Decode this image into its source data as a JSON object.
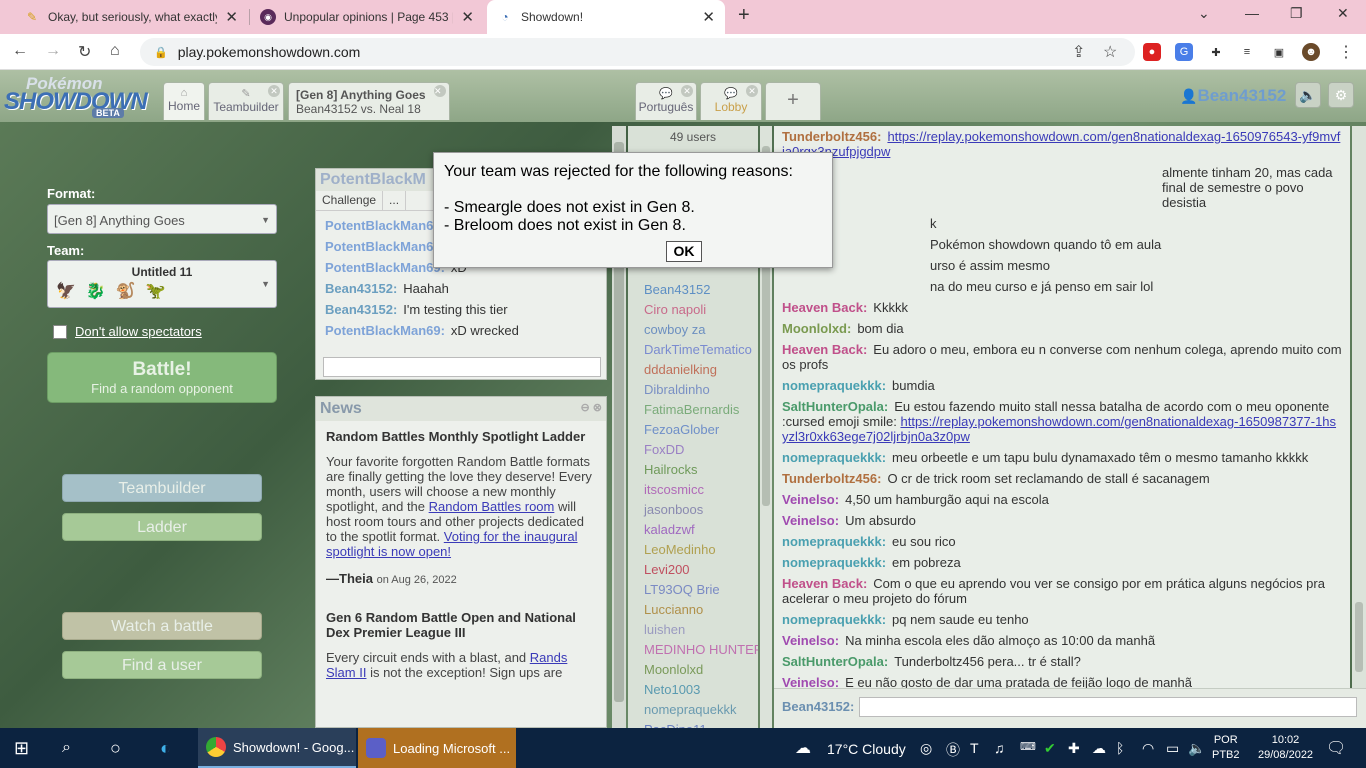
{
  "browser": {
    "tabs": [
      {
        "title": "Okay, but seriously, what exactly",
        "icon": "pencil-icon"
      },
      {
        "title": "Unpopular opinions | Page 453 | S",
        "icon": "forum-icon"
      },
      {
        "title": "Showdown!",
        "icon": "pokeball-icon"
      }
    ],
    "new_tab": "+",
    "url": "play.pokemonshowdown.com"
  },
  "ps_header": {
    "logo_top": "Pokémon",
    "logo_main": "SHOWDOWN",
    "logo_badge": "BETA",
    "home_label": "Home",
    "teambuilder_label": "Teambuilder",
    "room_title": "[Gen 8] Anything Goes",
    "room_sub": "Bean43152 vs. Neal 18",
    "portugues_label": "Português",
    "lobby_label": "Lobby",
    "add_label": "+",
    "username": "Bean43152"
  },
  "left": {
    "format_label": "Format:",
    "format_value": "[Gen 8] Anything Goes",
    "team_label": "Team:",
    "team_value": "Untitled 11",
    "team_mons": "🦅🐉🐒🦖",
    "spectators_label": "Don't allow spectators",
    "battle_label": "Battle!",
    "battle_sub": "Find a random opponent",
    "teambuilder_btn": "Teambuilder",
    "ladder_btn": "Ladder",
    "watch_btn": "Watch a battle",
    "find_btn": "Find a user"
  },
  "mini_chat": {
    "title": "PotentBlackM",
    "challenge": "Challenge",
    "more": "...",
    "rows": [
      {
        "name": "PotentBlackMan69:",
        "msg": "",
        "color": "#7ea3d8"
      },
      {
        "name": "PotentBlackMan69:",
        "msg": "",
        "color": "#7ea3d8"
      },
      {
        "name": "PotentBlackMan69:",
        "msg": "xD",
        "color": "#7ea3d8"
      },
      {
        "name": "Bean43152:",
        "msg": "Haahah",
        "color": "#6b9fc0"
      },
      {
        "name": "Bean43152:",
        "msg": "I'm testing this tier",
        "color": "#6b9fc0"
      },
      {
        "name": "PotentBlackMan69:",
        "msg": "xD wrecked",
        "color": "#7ea3d8"
      }
    ]
  },
  "news": {
    "title": "News",
    "item1_title": "Random Battles Monthly Spotlight Ladder",
    "item1_p1": "Your favorite forgotten Random Battle formats are finally getting the love they deserve! Every month, users will choose a new monthly spotlight, and the ",
    "item1_link1": "Random Battles room",
    "item1_p2": " will host room tours and other projects dedicated to the spotlit format. ",
    "item1_link2": "Voting for the inaugural spotlight is now open!",
    "item1_author": "—Theia",
    "item1_date": "on Aug 26, 2022",
    "item2_title": "Gen 6 Random Battle Open and National Dex Premier League III",
    "item2_p1": "Every circuit ends with a blast, and ",
    "item2_link1": "Rands Slam II",
    "item2_p2": " is not the exception! Sign ups are"
  },
  "userlist": {
    "count": "49 users",
    "users": [
      {
        "name": "Bean43152",
        "color": "#5e8fc4"
      },
      {
        "name": "Ciro napoli",
        "color": "#c86a8a"
      },
      {
        "name": "cowboy za",
        "color": "#6c8fc0"
      },
      {
        "name": "DarkTimeTematico",
        "color": "#7a8bd0"
      },
      {
        "name": "dddanielking",
        "color": "#c0705a"
      },
      {
        "name": "Dibraldinho",
        "color": "#7a90c4"
      },
      {
        "name": "FatimaBernardis",
        "color": "#7aab7a"
      },
      {
        "name": "FezoaGlober",
        "color": "#6f8fc8"
      },
      {
        "name": "FoxDD",
        "color": "#9a80c4"
      },
      {
        "name": "Hailrocks",
        "color": "#6f9a5a"
      },
      {
        "name": "itscosmicc",
        "color": "#b06ab8"
      },
      {
        "name": "jasonboos",
        "color": "#8a8ab0"
      },
      {
        "name": "kaladzwf",
        "color": "#a06ac0"
      },
      {
        "name": "LeoMedinho",
        "color": "#b0a050"
      },
      {
        "name": "Levi200",
        "color": "#c05060"
      },
      {
        "name": "LT93OQ Brie",
        "color": "#7a8ac4"
      },
      {
        "name": "Luccianno",
        "color": "#b0904a"
      },
      {
        "name": "luishen",
        "color": "#9a9ac0"
      },
      {
        "name": "MEDINHO HUNTER",
        "color": "#c070b0"
      },
      {
        "name": "Moonlolxd",
        "color": "#7a9a5a"
      },
      {
        "name": "Neto1003",
        "color": "#5a9ab0"
      },
      {
        "name": "nomepraquekkk",
        "color": "#6a9ab0"
      },
      {
        "name": "PacDino11",
        "color": "#6a80c0"
      }
    ]
  },
  "chat": {
    "messages": [
      {
        "name": "Tunderboltz456:",
        "msg": "",
        "link": "https://replay.pokemonshowdown.com/gen8nationaldexag-1650976543-yf9mvfja0rgx3nzufpjgdpw",
        "color": "#b07040"
      },
      {
        "name": "",
        "msg": "almente tinham 20, mas cada final de semestre o povo desistia",
        "link": "",
        "color": "#a05a8a"
      },
      {
        "name": "",
        "msg": "k",
        "link": "",
        "color": "#a05a8a"
      },
      {
        "name": "",
        "msg": "Pokémon showdown quando tô em aula",
        "link": "",
        "color": "#a05a8a"
      },
      {
        "name": "",
        "msg": "urso é assim mesmo",
        "link": "",
        "color": "#a05a8a"
      },
      {
        "name": "",
        "msg": "na do meu curso e já penso em sair lol",
        "link": "",
        "color": "#a05a8a"
      },
      {
        "name": "Heaven Back:",
        "msg": "Kkkkk",
        "link": "",
        "color": "#c0508a"
      },
      {
        "name": "Moonlolxd:",
        "msg": "bom dia",
        "link": "",
        "color": "#7a9a50"
      },
      {
        "name": "Heaven Back:",
        "msg": "Eu adoro o meu, embora eu n converse com nenhum colega, aprendo muito com os profs",
        "link": "",
        "color": "#c0508a"
      },
      {
        "name": "nomepraquekkk:",
        "msg": "bumdia",
        "link": "",
        "color": "#4aa0b0"
      },
      {
        "name": "SaltHunterOpala:",
        "msg": "Eu estou fazendo muito stall nessa batalha de acordo com o meu oponente :cursed emoji smile: ",
        "link": "https://replay.pokemonshowdown.com/gen8nationaldexag-1650987377-1hsyzl3r0xk63ege7j02ljrbjn0a3z0pw",
        "color": "#4a9a6a"
      },
      {
        "name": "nomepraquekkk:",
        "msg": "meu orbeetle e um tapu bulu dynamaxado têm o mesmo tamanho kkkkk",
        "link": "",
        "color": "#4aa0b0"
      },
      {
        "name": "Tunderboltz456:",
        "msg": "O cr de trick room set reclamando de stall é sacanagem",
        "link": "",
        "color": "#b07040"
      },
      {
        "name": "Veinelso:",
        "msg": "4,50 um hamburgão aqui na escola",
        "link": "",
        "color": "#a04ab0"
      },
      {
        "name": "Veinelso:",
        "msg": "Um absurdo",
        "link": "",
        "color": "#a04ab0"
      },
      {
        "name": "nomepraquekkk:",
        "msg": "eu sou rico",
        "link": "",
        "color": "#4aa0b0"
      },
      {
        "name": "nomepraquekkk:",
        "msg": "em pobreza",
        "link": "",
        "color": "#4aa0b0"
      },
      {
        "name": "Heaven Back:",
        "msg": "Com o que eu aprendo vou ver se consigo por em prática alguns negócios pra acelerar o meu projeto do fórum",
        "link": "",
        "color": "#c0508a"
      },
      {
        "name": "nomepraquekkk:",
        "msg": "pq nem saude eu tenho",
        "link": "",
        "color": "#4aa0b0"
      },
      {
        "name": "Veinelso:",
        "msg": "Na minha escola eles dão almoço as 10:00 da manhã",
        "link": "",
        "color": "#a04ab0"
      },
      {
        "name": "SaltHunterOpala:",
        "msg": "Tunderboltz456 pera... tr é stall?",
        "link": "",
        "color": "#4a9a6a"
      },
      {
        "name": "Veinelso:",
        "msg": "E eu não gosto de dar uma pratada de feijão logo de manhã",
        "link": "",
        "color": "#a04ab0"
      }
    ],
    "input_name": "Bean43152:"
  },
  "popup": {
    "heading": "Your team was rejected for the following reasons:",
    "line1": "- Smeargle does not exist in Gen 8.",
    "line2": "- Breloom does not exist in Gen 8.",
    "ok": "OK"
  },
  "taskbar": {
    "app1": "Showdown! - Goog...",
    "app2": "Loading Microsoft ...",
    "weather": "17°C  Cloudy",
    "lang1": "POR",
    "lang2": "PTB2",
    "time": "10:02",
    "date": "29/08/2022"
  }
}
